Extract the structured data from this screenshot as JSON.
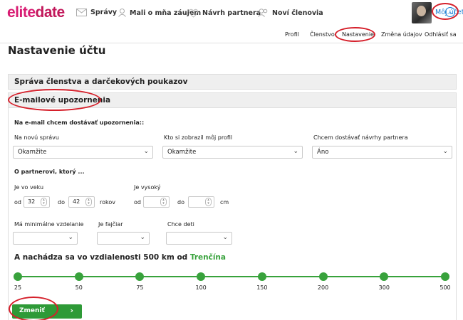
{
  "app": {
    "logo_part1": "elite",
    "logo_part2": "date"
  },
  "nav": {
    "messages": "Správy",
    "interested": "Mali o mňa záujem",
    "suggestions": "Návrh partnera",
    "new_members": "Noví členovia",
    "my_account": "Môj účet"
  },
  "subnav": [
    "Profil",
    "Členstvo",
    "Nastavenie",
    "Změna údajov",
    "Odhlásiť sa"
  ],
  "page": {
    "title": "Nastavenie účtu"
  },
  "sections": {
    "membership": "Správa členstva a darčekových poukazov",
    "email": "E-mailové upozornenia"
  },
  "form": {
    "intro": "Na e-mail chcem dostávať upozornenia::",
    "new_message": {
      "label": "Na novú správu",
      "value": "Okamžite"
    },
    "profile_view": {
      "label": "Kto si zobrazil môj profil",
      "value": "Okamžite"
    },
    "partner_suggest": {
      "label": "Chcem dostávať návrhy partnera",
      "value": "Áno"
    },
    "partner_heading": "O partnerovi, ktorý ...",
    "age": {
      "label": "Je vo veku",
      "from_label": "od",
      "from": "32",
      "to_label": "do",
      "to": "42",
      "unit": "rokov"
    },
    "height": {
      "label": "Je vysoký",
      "from_label": "od",
      "from": "",
      "to_label": "do",
      "to": "",
      "unit": "cm"
    },
    "education": {
      "label": "Má minimálne vzdelanie",
      "value": ""
    },
    "smoker": {
      "label": "Je fajčiar",
      "value": ""
    },
    "children": {
      "label": "Chce deti",
      "value": ""
    },
    "distance": {
      "prefix": "A nachádza sa vo vzdialenosti 500 km od",
      "city": "Trenčína"
    },
    "distance_ticks": [
      "25",
      "50",
      "75",
      "100",
      "150",
      "200",
      "300",
      "500"
    ],
    "submit": "Zmeniť"
  },
  "colors": {
    "accent_green": "#38a23c",
    "brand_pink": "#d81b72",
    "link_blue": "#1a7fd4",
    "annotation_red": "#d51f2a"
  }
}
